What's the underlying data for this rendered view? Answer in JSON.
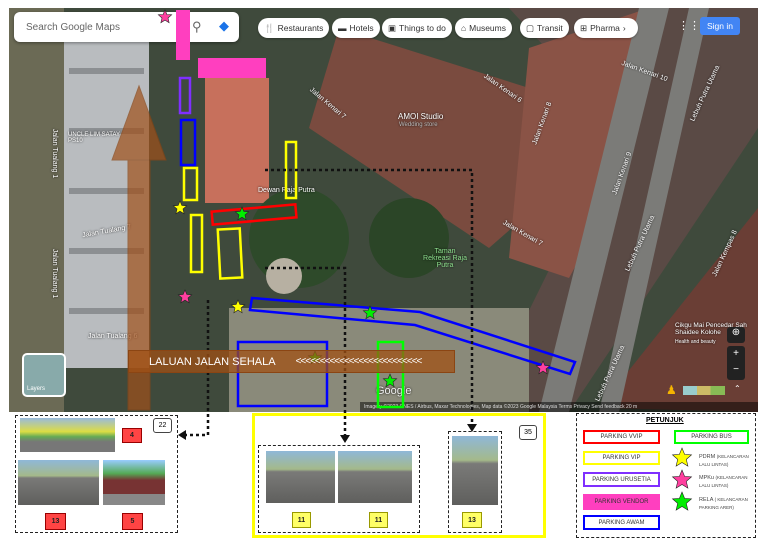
{
  "topbar": {
    "search_placeholder": "Search Google Maps",
    "chips": [
      "Restaurants",
      "Hotels",
      "Things to do",
      "Museums",
      "Transit",
      "Pharma"
    ],
    "sign_in": "Sign in"
  },
  "map_labels": {
    "amoi": "AMOI Studio",
    "amoi_sub": "Wedding store",
    "dewan": "Dewan Raja Putra",
    "taman": "Taman Rekreasi Raja Putra",
    "uncle": "UNCLE LIM SATAY PS10",
    "kenari7a": "Jalan Kenari 7",
    "kenari7b": "Jalan Kenari 7",
    "kenari6": "Jalan Kenari 6",
    "kenari8": "Jalan Kenari 8",
    "kenari9": "Jalan Kenari 9",
    "kenari10": "Jalan Kenari 10",
    "lebuh1": "Lebuh Putra Utama",
    "lebuh2": "Lebuh Putra Utama",
    "lebuh3": "Lebuh Putra Utama",
    "kempas": "Jalan Kempas 8",
    "tualang1": "Jalan Tualang 1",
    "tualang1b": "Jalan Tualang 1",
    "tualang7": "Jalan Tualang 7",
    "tualang6": "Jalan Tualang 6",
    "cikgu": "Cikgu Mai Pencedar Sah Shaidee Kolohe",
    "cikgu_sub": "Health and beauty",
    "google": "Google",
    "layers": "Layers",
    "attribution": "Imagery ©2023 CNES / Airbus, Maxar Technologies, Map data ©2023 Google   Malaysia   Terms   Privacy   Send feedback   20 m"
  },
  "banner": {
    "text": "LALUAN JALAN SEHALA",
    "arrows": "<<<<<<<<<<<<<<<<<<<<<<<<<<"
  },
  "panel_left": {
    "count": "22",
    "labels": [
      "4",
      "13",
      "5"
    ]
  },
  "panel_mid": {
    "count": "35",
    "labels": [
      "11",
      "11",
      "13"
    ]
  },
  "legend": {
    "title": "PETUNJUK",
    "parking": [
      {
        "label": "PARKING VVIP",
        "color": "#ff0000"
      },
      {
        "label": "PARKING VIP",
        "color": "#ffff00"
      },
      {
        "label": "PARKING URUSETIA",
        "color": "#7f2fff"
      },
      {
        "label": "PARKING VENDOR",
        "color": "#ff3fbf"
      },
      {
        "label": "PARKING AWAM",
        "color": "#0000ff"
      },
      {
        "label": "PARKING BUS",
        "color": "#00ff00"
      }
    ],
    "stars": [
      {
        "name": "PDRM",
        "desc": "(KELANCARAN LALU LINTAS)",
        "color": "#ffff00"
      },
      {
        "name": "MPKu",
        "desc": "(KELANCARAN LALU LINTAS)",
        "color": "#ff3f9f"
      },
      {
        "name": "RELA",
        "desc": "( KELANCARAN PARKING ARER)",
        "color": "#00ee00"
      }
    ]
  }
}
